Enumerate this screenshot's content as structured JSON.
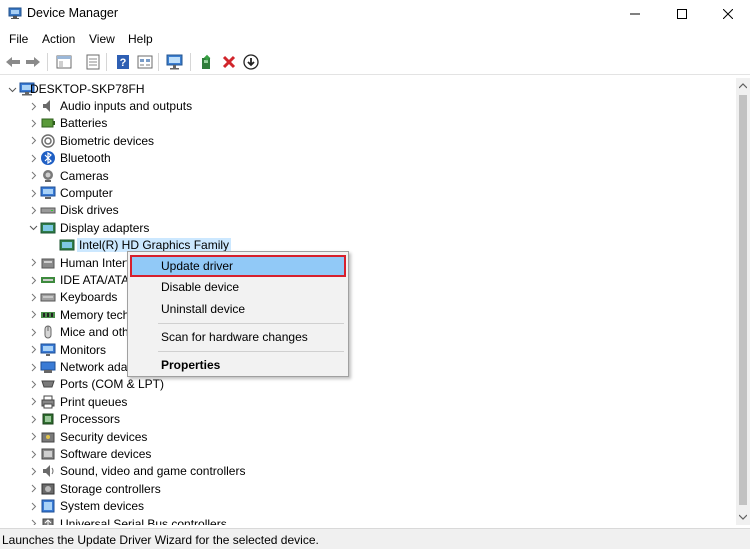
{
  "window": {
    "title": "Device Manager",
    "minimize_glyph": "—",
    "close_glyph": "✕"
  },
  "menu": [
    "File",
    "Action",
    "View",
    "Help"
  ],
  "toolbar_icons": [
    "back-arrow-icon",
    "forward-arrow-icon",
    "show-hide-tree-icon",
    "properties-icon",
    "help-icon",
    "view-icon",
    "scan-monitor-icon",
    "update-driver-icon",
    "uninstall-x-icon",
    "disable-download-icon"
  ],
  "tree": {
    "root": "DESKTOP-SKP78FH",
    "items": [
      {
        "label": "Audio inputs and outputs",
        "icon": "speaker-icon"
      },
      {
        "label": "Batteries",
        "icon": "battery-icon"
      },
      {
        "label": "Biometric devices",
        "icon": "fingerprint-icon"
      },
      {
        "label": "Bluetooth",
        "icon": "bluetooth-icon"
      },
      {
        "label": "Cameras",
        "icon": "camera-icon"
      },
      {
        "label": "Computer",
        "icon": "computer-icon"
      },
      {
        "label": "Disk drives",
        "icon": "disk-drive-icon"
      },
      {
        "label": "Display adapters",
        "icon": "display-adapter-icon",
        "expanded": true
      },
      {
        "label": "Intel(R) HD Graphics Family",
        "icon": "display-adapter-icon",
        "child": true
      },
      {
        "label": "Human Interf",
        "icon": "hid-icon"
      },
      {
        "label": "IDE ATA/ATAP",
        "icon": "ide-icon"
      },
      {
        "label": "Keyboards",
        "icon": "keyboard-icon"
      },
      {
        "label": "Memory tech",
        "icon": "memory-icon"
      },
      {
        "label": "Mice and oth",
        "icon": "mouse-icon"
      },
      {
        "label": "Monitors",
        "icon": "monitor-icon"
      },
      {
        "label": "Network ada",
        "icon": "network-icon"
      },
      {
        "label": "Ports (COM & LPT)",
        "icon": "port-icon"
      },
      {
        "label": "Print queues",
        "icon": "printer-icon"
      },
      {
        "label": "Processors",
        "icon": "processor-icon"
      },
      {
        "label": "Security devices",
        "icon": "security-icon"
      },
      {
        "label": "Software devices",
        "icon": "software-icon"
      },
      {
        "label": "Sound, video and game controllers",
        "icon": "sound-icon"
      },
      {
        "label": "Storage controllers",
        "icon": "storage-icon"
      },
      {
        "label": "System devices",
        "icon": "system-icon"
      },
      {
        "label": "Universal Serial Bus controllers",
        "icon": "usb-icon"
      }
    ]
  },
  "context_menu": {
    "items": [
      "Update driver",
      "Disable device",
      "Uninstall device",
      "Scan for hardware changes",
      "Properties"
    ],
    "highlighted": "Update driver"
  },
  "status": "Launches the Update Driver Wizard for the selected device.",
  "colors": {
    "highlight": "#91c9f7",
    "highlight_border": "#d7202d",
    "selection": "#cce8ff"
  }
}
